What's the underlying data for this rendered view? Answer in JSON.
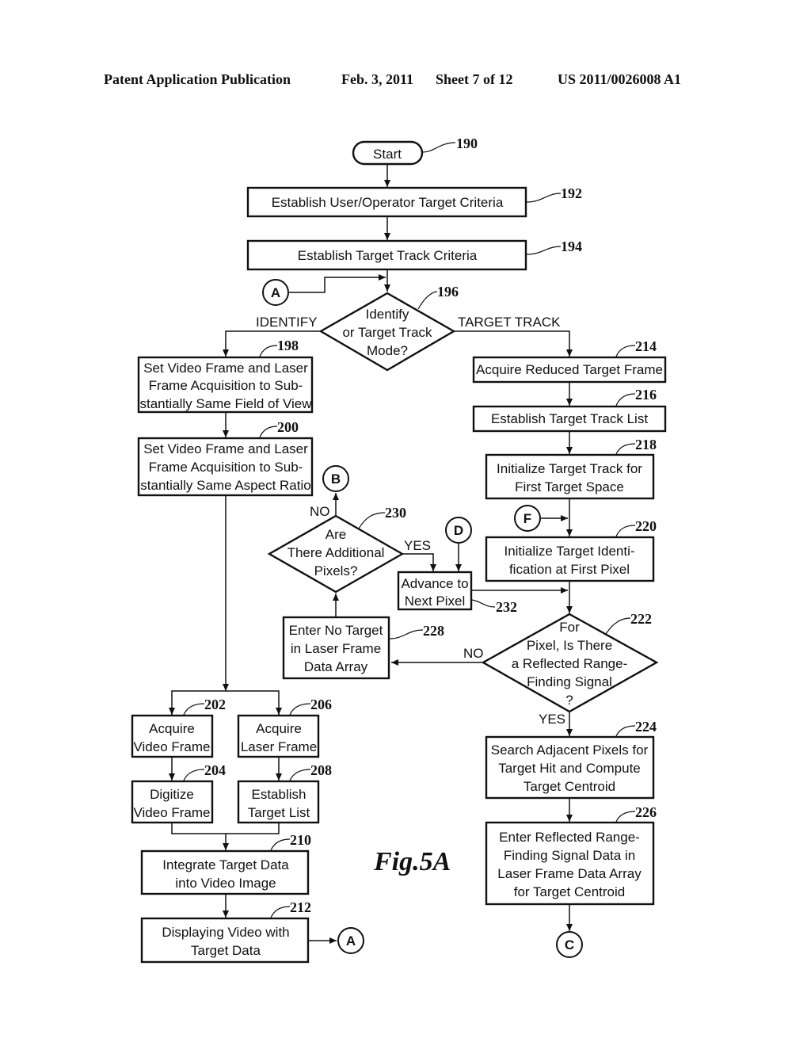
{
  "header": {
    "publication": "Patent Application Publication",
    "date": "Feb. 3, 2011",
    "sheet": "Sheet 7 of 12",
    "number": "US 2011/0026008 A1"
  },
  "figure_label": "Fig.5A",
  "nodes": {
    "n190": {
      "ref": "190",
      "lines": [
        "Start"
      ]
    },
    "n192": {
      "ref": "192",
      "lines": [
        "Establish User/Operator Target Criteria"
      ]
    },
    "n194": {
      "ref": "194",
      "lines": [
        "Establish Target Track Criteria"
      ]
    },
    "n196": {
      "ref": "196",
      "lines": [
        "Identify",
        "or Target Track",
        "Mode?"
      ]
    },
    "n198": {
      "ref": "198",
      "lines": [
        "Set Video Frame and Laser",
        "Frame Acquisition to Sub-",
        "stantially Same Field of View"
      ]
    },
    "n200": {
      "ref": "200",
      "lines": [
        "Set Video Frame and Laser",
        "Frame Acquisition to Sub-",
        "stantially Same Aspect Ratio"
      ]
    },
    "n202": {
      "ref": "202",
      "lines": [
        "Acquire",
        "Video Frame"
      ]
    },
    "n204": {
      "ref": "204",
      "lines": [
        "Digitize",
        "Video Frame"
      ]
    },
    "n206": {
      "ref": "206",
      "lines": [
        "Acquire",
        "Laser Frame"
      ]
    },
    "n208": {
      "ref": "208",
      "lines": [
        "Establish",
        "Target List"
      ]
    },
    "n210": {
      "ref": "210",
      "lines": [
        "Integrate Target Data",
        "into Video Image"
      ]
    },
    "n212": {
      "ref": "212",
      "lines": [
        "Displaying Video with",
        "Target Data"
      ]
    },
    "n214": {
      "ref": "214",
      "lines": [
        "Acquire Reduced Target Frame"
      ]
    },
    "n216": {
      "ref": "216",
      "lines": [
        "Establish Target Track List"
      ]
    },
    "n218": {
      "ref": "218",
      "lines": [
        "Initialize Target Track for",
        "First Target Space"
      ]
    },
    "n220": {
      "ref": "220",
      "lines": [
        "Initialize Target Identi-",
        "fication at First Pixel"
      ]
    },
    "n222": {
      "ref": "222",
      "lines": [
        "For",
        "Pixel, Is There",
        "a Reflected Range-",
        "Finding Signal",
        "?"
      ]
    },
    "n224": {
      "ref": "224",
      "lines": [
        "Search Adjacent Pixels for",
        "Target Hit and Compute",
        "Target Centroid"
      ]
    },
    "n226": {
      "ref": "226",
      "lines": [
        "Enter Reflected Range-",
        "Finding Signal Data in",
        "Laser Frame Data Array",
        "for Target Centroid"
      ]
    },
    "n228": {
      "ref": "228",
      "lines": [
        "Enter No Target",
        "in Laser Frame",
        "Data Array"
      ]
    },
    "n230": {
      "ref": "230",
      "lines": [
        "Are",
        "There Additional",
        "Pixels?"
      ]
    },
    "n232": {
      "ref": "232",
      "lines": [
        "Advance to",
        "Next Pixel"
      ]
    }
  },
  "connectors": {
    "a_top": "A",
    "a_bottom": "A",
    "b": "B",
    "c": "C",
    "d": "D",
    "f": "F"
  },
  "edge_labels": {
    "identify": "IDENTIFY",
    "target_track": "TARGET TRACK",
    "no_230": "NO",
    "yes_230": "YES",
    "no_222": "NO",
    "yes_222": "YES"
  }
}
